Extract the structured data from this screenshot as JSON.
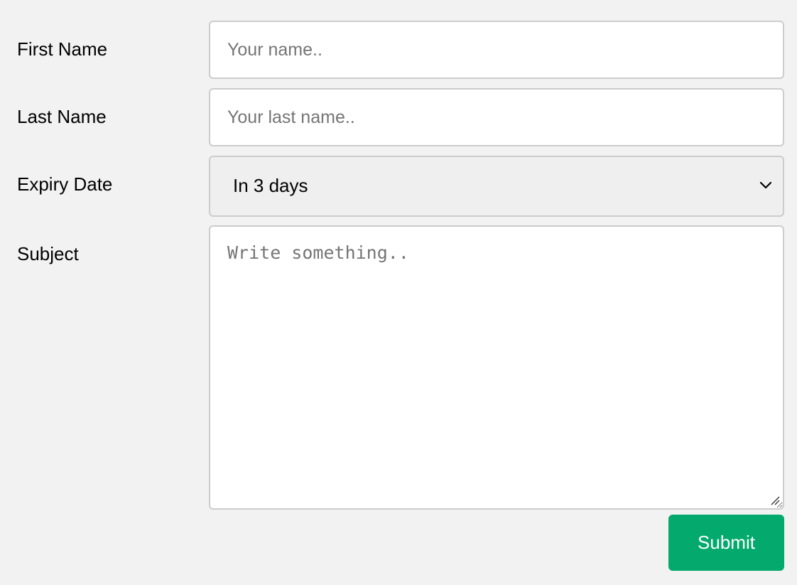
{
  "form": {
    "first_name": {
      "label": "First Name",
      "placeholder": "Your name..",
      "value": ""
    },
    "last_name": {
      "label": "Last Name",
      "placeholder": "Your last name..",
      "value": ""
    },
    "expiry_date": {
      "label": "Expiry Date",
      "selected": "In 3 days"
    },
    "subject": {
      "label": "Subject",
      "placeholder": "Write something..",
      "value": ""
    },
    "submit_label": "Submit"
  },
  "icons": {
    "select_arrow": "chevron-down-icon",
    "textarea_grip": "resize-grip-icon"
  },
  "colors": {
    "background": "#f2f2f2",
    "submit_button": "#04aa6d",
    "select_background": "#efefef",
    "field_border": "#cccccc"
  }
}
